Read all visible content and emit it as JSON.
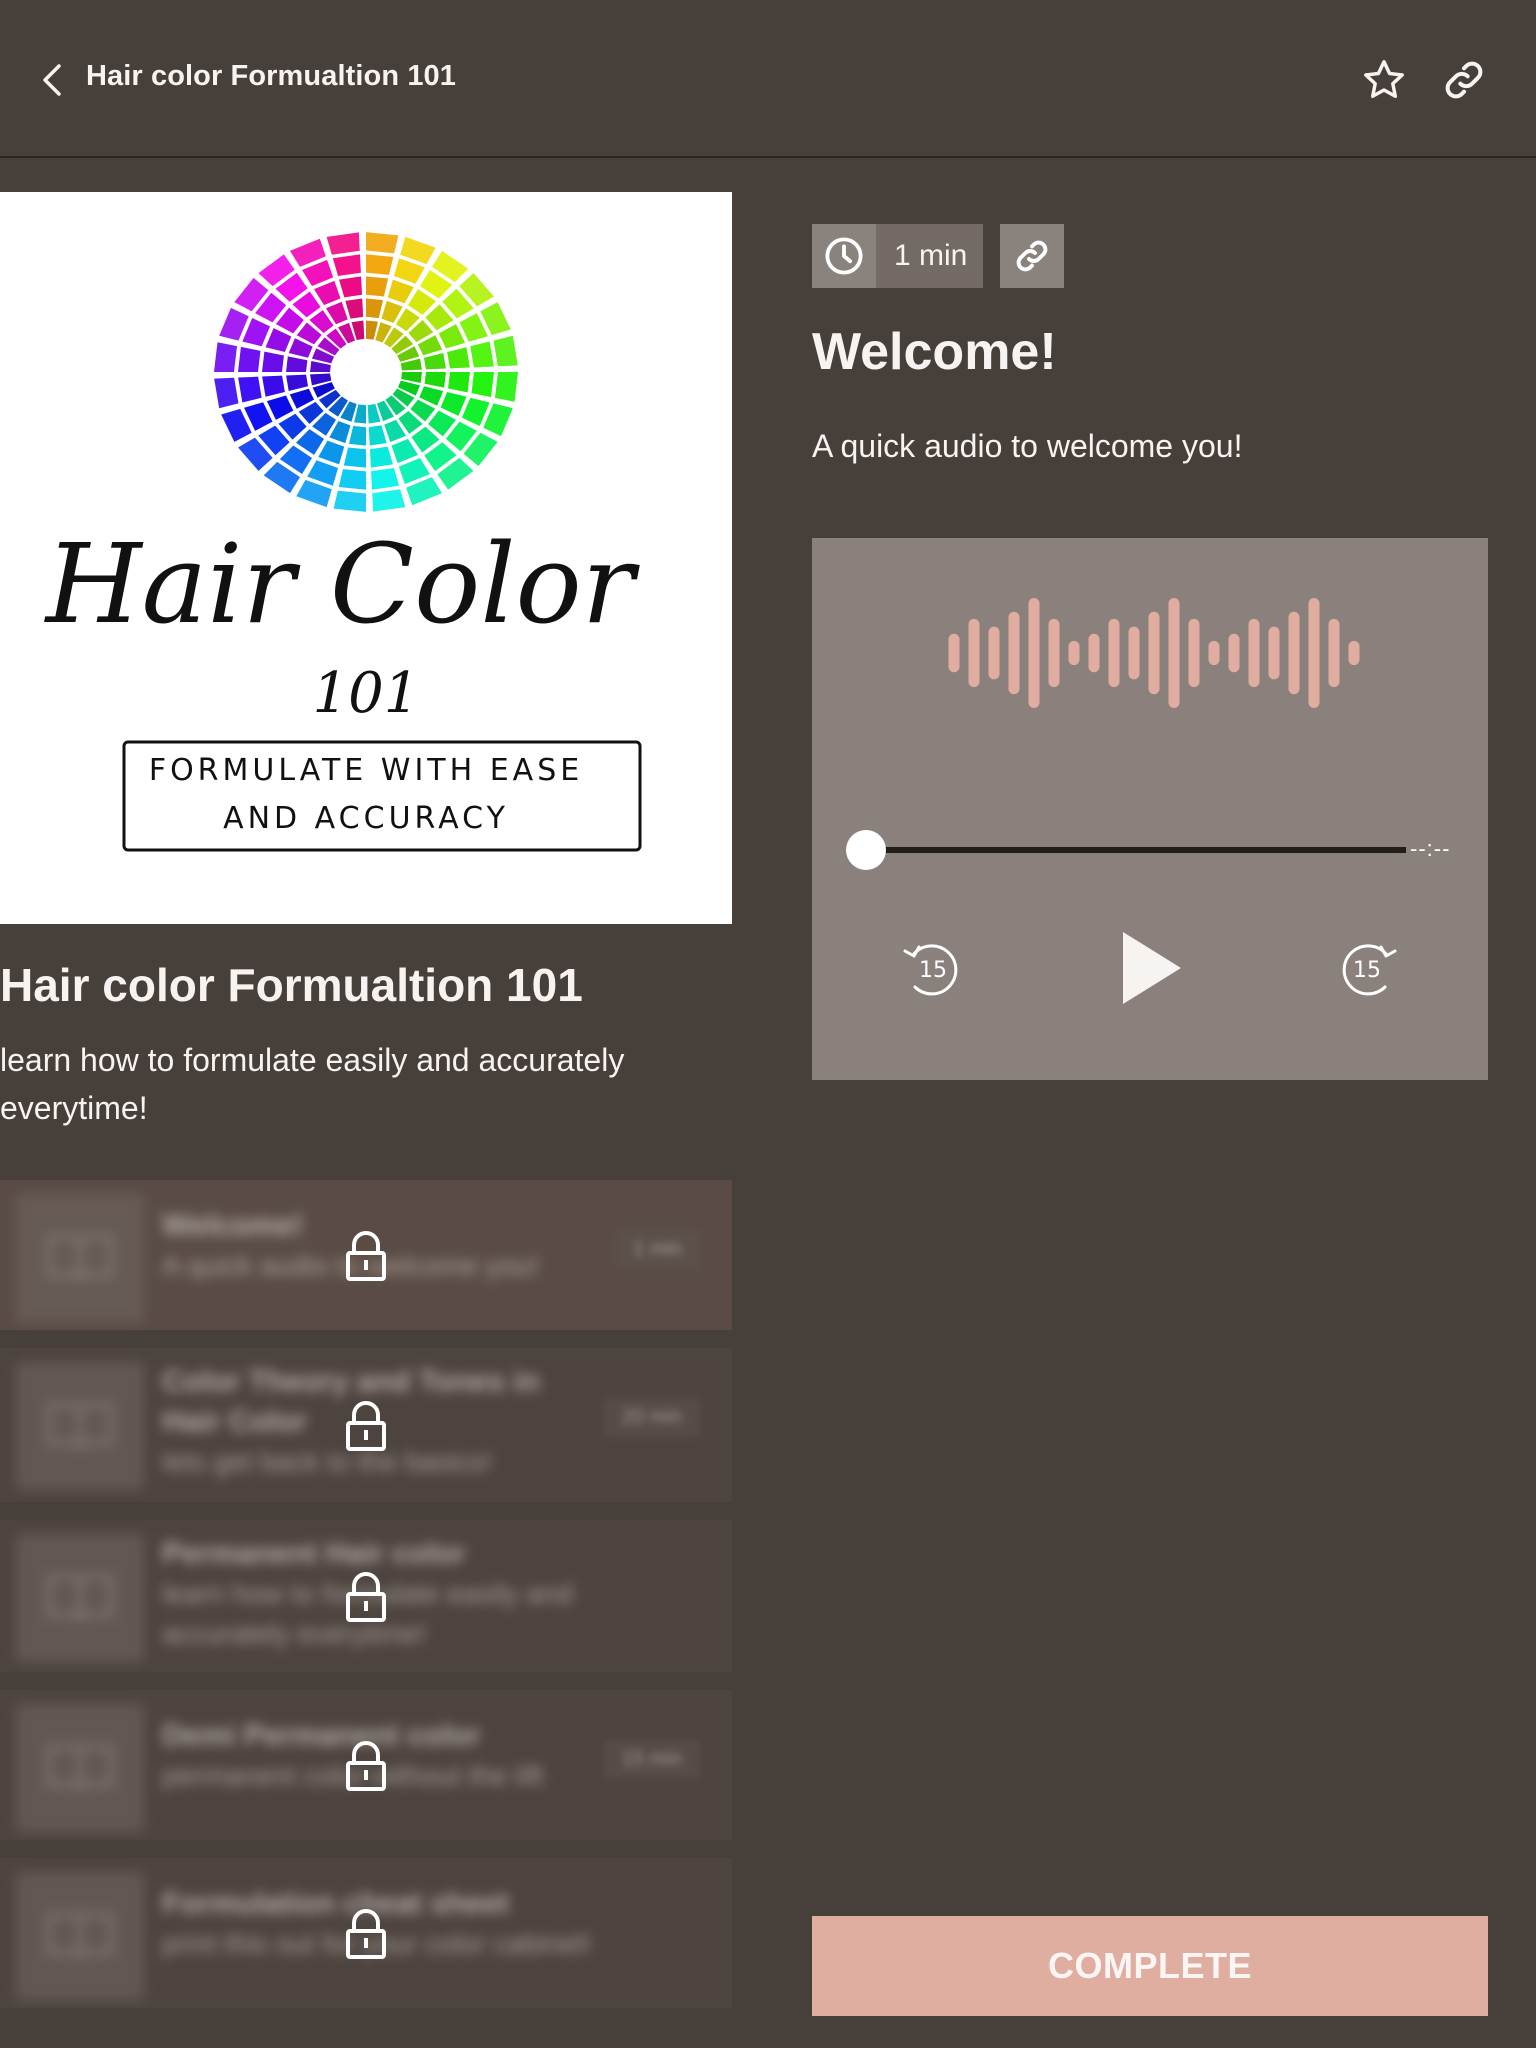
{
  "header": {
    "title": "Hair color Formualtion 101",
    "back_icon": "chevron-left-icon",
    "favorite_icon": "star-outline-icon",
    "share_icon": "link-icon"
  },
  "course": {
    "image": {
      "alt": "Hair Color 101 logo",
      "script_title": "Hair Color",
      "number": "101",
      "tagline_line1": "FORMULATE WITH EASE",
      "tagline_line2": "AND ACCURACY"
    },
    "title": "Hair color Formualtion 101",
    "description": "learn how to formulate easily and accurately everytime!"
  },
  "lessons": [
    {
      "title": "Welcome!",
      "description": "A quick audio to welcome you!",
      "duration": "1 min",
      "locked": true
    },
    {
      "title": "Color Theory and Tones in Hair Color",
      "description": "lets get back to the basics!",
      "duration": "20 min",
      "locked": true
    },
    {
      "title": "Permanent Hair color",
      "description": "learn how to formulate easily and accurately everytime!",
      "duration": "",
      "locked": true
    },
    {
      "title": "Demi Permanent color",
      "description": "permanent color without the lift",
      "duration": "15 min",
      "locked": true
    },
    {
      "title": "Formulation cheat sheet",
      "description": "print this out for your color cabinet!",
      "duration": "",
      "locked": true
    }
  ],
  "current_lesson": {
    "duration": "1 min",
    "title": "Welcome!",
    "description": "A quick audio to welcome you!"
  },
  "player": {
    "time_display": "--:--",
    "progress": 0,
    "rewind_label": "15",
    "forward_label": "15",
    "waveform_levels": [
      0.35,
      0.62,
      0.48,
      0.75,
      1.0,
      0.62,
      0.22,
      0.35,
      0.62,
      0.48,
      0.75,
      1.0,
      0.62,
      0.22,
      0.35,
      0.62,
      0.48,
      0.75,
      1.0,
      0.62,
      0.22
    ]
  },
  "actions": {
    "complete_label": "COMPLETE"
  },
  "colors": {
    "background": "#473f3a",
    "accent": "#dfaea0",
    "player_bg": "#8a817c",
    "waveform": "#e0ada0"
  }
}
